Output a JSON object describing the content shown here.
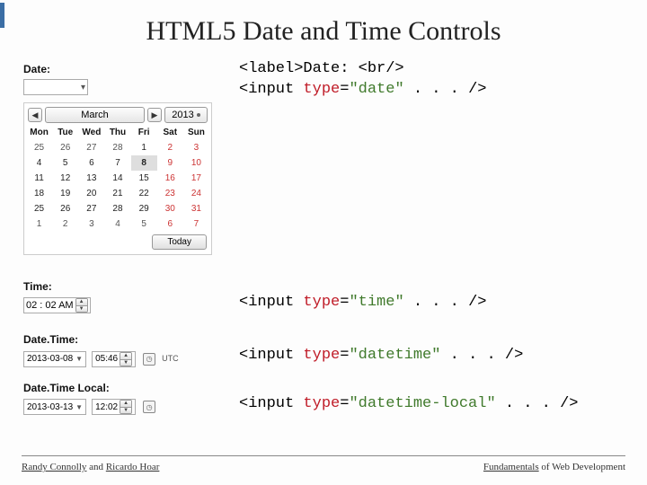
{
  "title": "HTML5 Date and Time Controls",
  "labels": {
    "date": "Date:",
    "time": "Time:",
    "datetime": "Date.Time:",
    "datetime_local": "Date.Time Local:"
  },
  "date_picker": {
    "month": "March",
    "year": "2013",
    "days": [
      "Mon",
      "Tue",
      "Wed",
      "Thu",
      "Fri",
      "Sat",
      "Sun"
    ],
    "weeks": [
      [
        {
          "n": 25,
          "out": true
        },
        {
          "n": 26,
          "out": true
        },
        {
          "n": 27,
          "out": true
        },
        {
          "n": 28,
          "out": true
        },
        {
          "n": 1
        },
        {
          "n": 2,
          "wk": true
        },
        {
          "n": 3,
          "wk": true
        }
      ],
      [
        {
          "n": 4
        },
        {
          "n": 5
        },
        {
          "n": 6
        },
        {
          "n": 7
        },
        {
          "n": 8,
          "sel": true
        },
        {
          "n": 9,
          "wk": true
        },
        {
          "n": 10,
          "wk": true
        }
      ],
      [
        {
          "n": 11
        },
        {
          "n": 12
        },
        {
          "n": 13
        },
        {
          "n": 14
        },
        {
          "n": 15
        },
        {
          "n": 16,
          "wk": true
        },
        {
          "n": 17,
          "wk": true
        }
      ],
      [
        {
          "n": 18
        },
        {
          "n": 19
        },
        {
          "n": 20
        },
        {
          "n": 21
        },
        {
          "n": 22
        },
        {
          "n": 23,
          "wk": true
        },
        {
          "n": 24,
          "wk": true
        }
      ],
      [
        {
          "n": 25
        },
        {
          "n": 26
        },
        {
          "n": 27
        },
        {
          "n": 28
        },
        {
          "n": 29
        },
        {
          "n": 30,
          "wk": true
        },
        {
          "n": 31,
          "wk": true
        }
      ],
      [
        {
          "n": 1,
          "out": true
        },
        {
          "n": 2,
          "out": true
        },
        {
          "n": 3,
          "out": true
        },
        {
          "n": 4,
          "out": true
        },
        {
          "n": 5,
          "out": true
        },
        {
          "n": 6,
          "out": true,
          "wk": true
        },
        {
          "n": 7,
          "out": true,
          "wk": true
        }
      ]
    ],
    "today": "Today"
  },
  "time_value": "02 : 02   AM",
  "datetime_value": {
    "date": "2013-03-08",
    "time": "05:46"
  },
  "datetime_local_value": {
    "date": "2013-03-13",
    "time": "12:02"
  },
  "utc": "UTC",
  "code": {
    "date_l1_a": "<label>Date: <br/>",
    "date_l2_a": "<input ",
    "date_l2_b": "type",
    "date_l2_c": "=",
    "date_l2_d": "\"date\"",
    "date_l2_e": " . . . />",
    "time_a": "<input ",
    "time_b": "type",
    "time_c": "=",
    "time_d": "\"time\"",
    "time_e": " . . . />",
    "dt_a": "<input ",
    "dt_b": "type",
    "dt_c": "=",
    "dt_d": "\"datetime\"",
    "dt_e": " . . . />",
    "dtl_a": "<input ",
    "dtl_b": "type",
    "dtl_c": "=",
    "dtl_d": "\"datetime-local\"",
    "dtl_e": " . . . />"
  },
  "footer": {
    "left_a": "Randy Connolly",
    "left_b": " and ",
    "left_c": "Ricardo Hoar",
    "right_a": "Fundamentals",
    "right_b": " of Web Development"
  }
}
